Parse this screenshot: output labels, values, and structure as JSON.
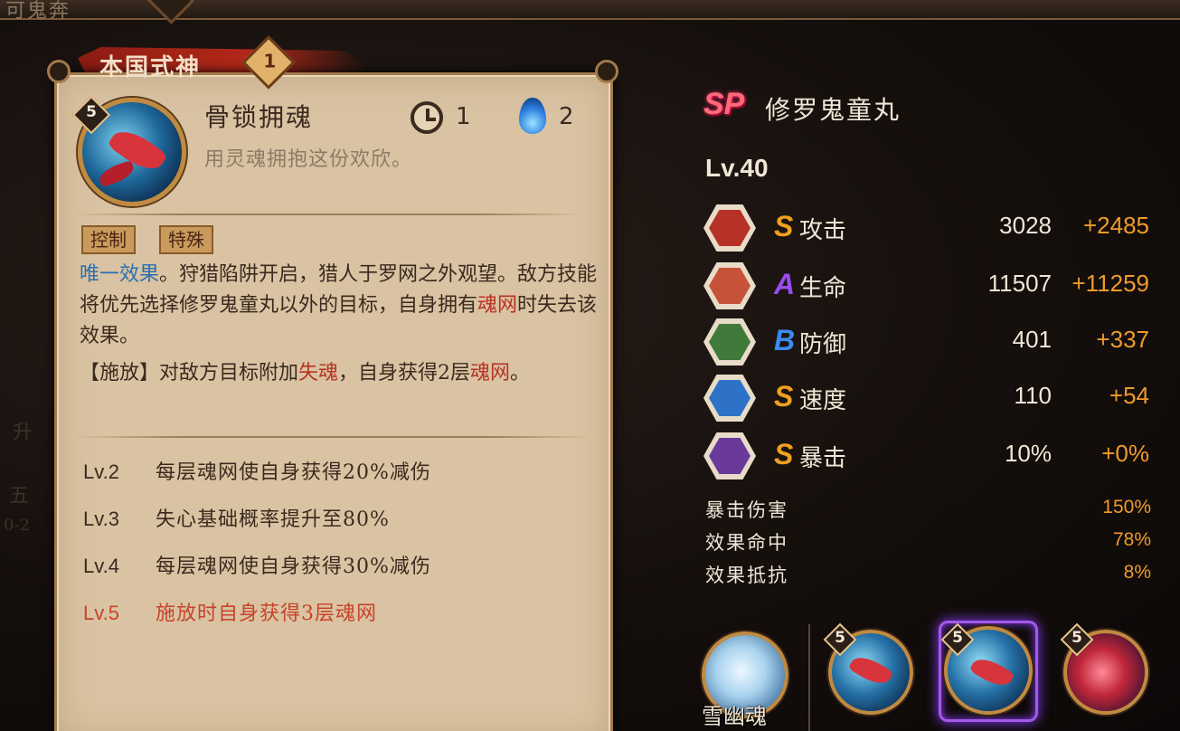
{
  "header": {
    "crumb": "可鬼奔",
    "panel_title": "本国式神",
    "panel_badge": "1"
  },
  "background_text": {
    "left_1": "升",
    "left_2": "五",
    "left_3": "0-2"
  },
  "skill": {
    "level": "5",
    "name": "骨锁拥魂",
    "subtitle": "用灵魂拥抱这份欢欣。",
    "cooldown": "1",
    "cost": "2",
    "tags": [
      "控制",
      "特殊"
    ],
    "desc": {
      "p1_blue": "唯一效果",
      "p1_a": "。狩猎陷阱开启，猎人于罗网之外观望。敌方技能将优先选择修罗鬼童丸以外的目标，自身拥有",
      "p1_red": "魂网",
      "p1_b": "时失去该效果。",
      "p2_a": "【施放】对敌方目标附加",
      "p2_red1": "失魂",
      "p2_b": "，自身获得2层",
      "p2_red2": "魂网",
      "p2_c": "。"
    },
    "levels": [
      {
        "lv": "Lv.2",
        "text": "每层魂网使自身获得20%减伤",
        "highlight": false
      },
      {
        "lv": "Lv.3",
        "text": "失心基础概率提升至80%",
        "highlight": false
      },
      {
        "lv": "Lv.4",
        "text": "每层魂网使自身获得30%减伤",
        "highlight": false
      },
      {
        "lv": "Lv.5",
        "text": "施放时自身获得3层魂网",
        "highlight": true
      }
    ]
  },
  "character": {
    "rarity": "SP",
    "name": "修罗鬼童丸",
    "level": "Lv.40",
    "stats": [
      {
        "icon": "attack-icon",
        "grade": "S",
        "grade_color": "#f0a020",
        "label": "攻击",
        "base": "3028",
        "bonus": "+2485"
      },
      {
        "icon": "health-icon",
        "grade": "A",
        "grade_color": "#9a4cf0",
        "label": "生命",
        "base": "11507",
        "bonus": "+11259"
      },
      {
        "icon": "defense-icon",
        "grade": "B",
        "grade_color": "#3a8cf0",
        "label": "防御",
        "base": "401",
        "bonus": "+337"
      },
      {
        "icon": "speed-icon",
        "grade": "S",
        "grade_color": "#f0a020",
        "label": "速度",
        "base": "110",
        "bonus": "+54"
      },
      {
        "icon": "crit-icon",
        "grade": "S",
        "grade_color": "#f0a020",
        "label": "暴击",
        "base": "10%",
        "bonus": "+0%"
      }
    ],
    "sub_stats": [
      {
        "label": "暴击伤害",
        "value": "150%"
      },
      {
        "label": "效果命中",
        "value": "78%"
      },
      {
        "label": "效果抵抗",
        "value": "8%"
      }
    ]
  },
  "bottom": {
    "soul_label": "雪幽魂",
    "skill_levels": [
      "5",
      "5",
      "5"
    ]
  }
}
